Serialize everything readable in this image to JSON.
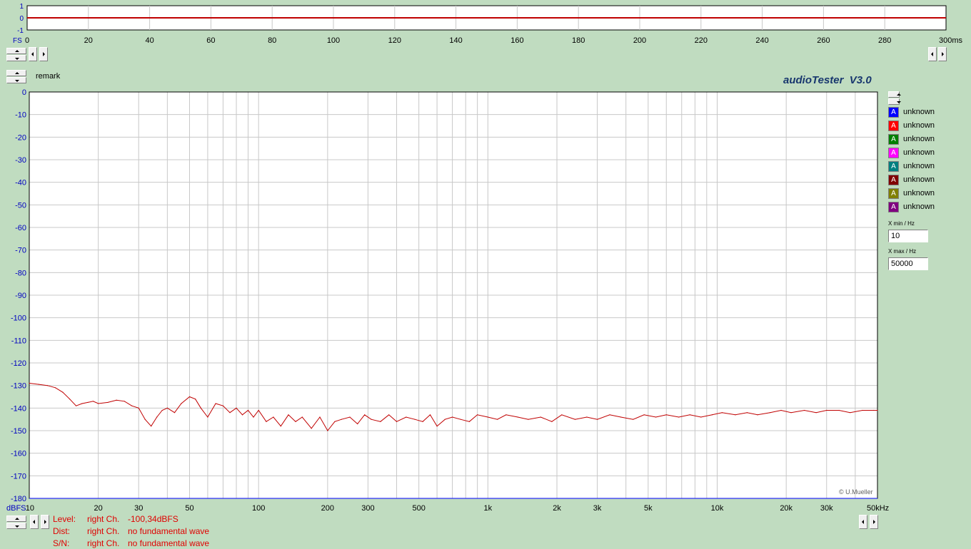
{
  "app": {
    "brand": "audioTester  V3.0",
    "remark": "remark",
    "copyright": "© U.Mueller"
  },
  "time_chart": {
    "y_ticks": [
      "1",
      "0",
      "-1"
    ],
    "x_ticks": [
      "0",
      "20",
      "40",
      "60",
      "80",
      "100",
      "120",
      "140",
      "160",
      "180",
      "200",
      "220",
      "240",
      "260",
      "280",
      "300"
    ],
    "x_unit": "ms",
    "y_unit": "FS"
  },
  "legend": {
    "items": [
      {
        "label": "unknown",
        "color": "#0000ff"
      },
      {
        "label": "unknown",
        "color": "#ff0000"
      },
      {
        "label": "unknown",
        "color": "#008000"
      },
      {
        "label": "unknown",
        "color": "#ff00ff"
      },
      {
        "label": "unknown",
        "color": "#008080"
      },
      {
        "label": "unknown",
        "color": "#800000"
      },
      {
        "label": "unknown",
        "color": "#808000"
      },
      {
        "label": "unknown",
        "color": "#800080"
      }
    ],
    "swatch_glyph": "A"
  },
  "controls": {
    "xmin_label": "X min / Hz",
    "xmin_value": "10",
    "xmax_label": "X max / Hz",
    "xmax_value": "50000"
  },
  "status": {
    "rows": [
      {
        "key": "Level:",
        "ch": "right Ch.",
        "val": "-100,34dBFS"
      },
      {
        "key": "Dist:",
        "ch": "right Ch.",
        "val": "no fundamental wave"
      },
      {
        "key": "S/N:",
        "ch": "right Ch.",
        "val": "no fundamental wave"
      }
    ]
  },
  "chart_data": {
    "type": "line",
    "xscale": "log",
    "xlim": [
      10,
      50000
    ],
    "ylim": [
      -180,
      0
    ],
    "ylabel": "dBFS",
    "xlabel": "Hz",
    "y_ticks": [
      "0",
      "-10",
      "-20",
      "-30",
      "-40",
      "-50",
      "-60",
      "-70",
      "-80",
      "-90",
      "-100",
      "-110",
      "-120",
      "-130",
      "-140",
      "-150",
      "-160",
      "-170",
      "-180"
    ],
    "x_ticks": [
      {
        "v": 10,
        "l": "10"
      },
      {
        "v": 20,
        "l": "20"
      },
      {
        "v": 30,
        "l": "30"
      },
      {
        "v": 50,
        "l": "50"
      },
      {
        "v": 100,
        "l": "100"
      },
      {
        "v": 200,
        "l": "200"
      },
      {
        "v": 300,
        "l": "300"
      },
      {
        "v": 500,
        "l": "500"
      },
      {
        "v": 1000,
        "l": "1k"
      },
      {
        "v": 2000,
        "l": "2k"
      },
      {
        "v": 3000,
        "l": "3k"
      },
      {
        "v": 5000,
        "l": "5k"
      },
      {
        "v": 10000,
        "l": "10k"
      },
      {
        "v": 20000,
        "l": "20k"
      },
      {
        "v": 30000,
        "l": "30k"
      },
      {
        "v": 50000,
        "l": "50kHz"
      }
    ],
    "grid": true,
    "series": [
      {
        "color": "#c00000",
        "x": [
          10,
          11,
          12,
          13,
          14,
          15,
          16,
          17,
          18,
          19,
          20,
          22,
          24,
          26,
          28,
          30,
          32,
          34,
          36,
          38,
          40,
          43,
          46,
          50,
          53,
          56,
          60,
          65,
          70,
          75,
          80,
          85,
          90,
          95,
          100,
          108,
          116,
          125,
          135,
          145,
          155,
          170,
          185,
          200,
          215,
          230,
          250,
          270,
          290,
          310,
          340,
          370,
          400,
          440,
          480,
          520,
          560,
          600,
          650,
          700,
          760,
          830,
          900,
          1000,
          1100,
          1200,
          1350,
          1500,
          1700,
          1900,
          2100,
          2400,
          2700,
          3000,
          3400,
          3800,
          4300,
          4800,
          5400,
          6000,
          6800,
          7600,
          8500,
          9500,
          10500,
          12000,
          13500,
          15000,
          17000,
          19000,
          21000,
          24000,
          27000,
          30000,
          34000,
          38000,
          43000,
          48000,
          50000
        ],
        "y": [
          -129,
          -129.5,
          -130,
          -131,
          -133,
          -136,
          -139,
          -138,
          -137.5,
          -137,
          -138,
          -137.5,
          -136.5,
          -137,
          -139,
          -140,
          -145,
          -148,
          -144,
          -141,
          -140,
          -142,
          -138,
          -135,
          -136,
          -140,
          -144,
          -138,
          -139,
          -142,
          -140,
          -143,
          -141,
          -144,
          -141,
          -146,
          -144,
          -148,
          -143,
          -146,
          -144,
          -149,
          -144,
          -150,
          -146,
          -145,
          -144,
          -147,
          -143,
          -145,
          -146,
          -143,
          -146,
          -144,
          -145,
          -146,
          -143,
          -148,
          -145,
          -144,
          -145,
          -146,
          -143,
          -144,
          -145,
          -143,
          -144,
          -145,
          -144,
          -146,
          -143,
          -145,
          -144,
          -145,
          -143,
          -144,
          -145,
          -143,
          -144,
          -143,
          -144,
          -143,
          -144,
          -143,
          -142,
          -143,
          -142,
          -143,
          -142,
          -141,
          -142,
          -141,
          -142,
          -141,
          -141,
          -142,
          -141,
          -141,
          -141
        ]
      }
    ]
  }
}
